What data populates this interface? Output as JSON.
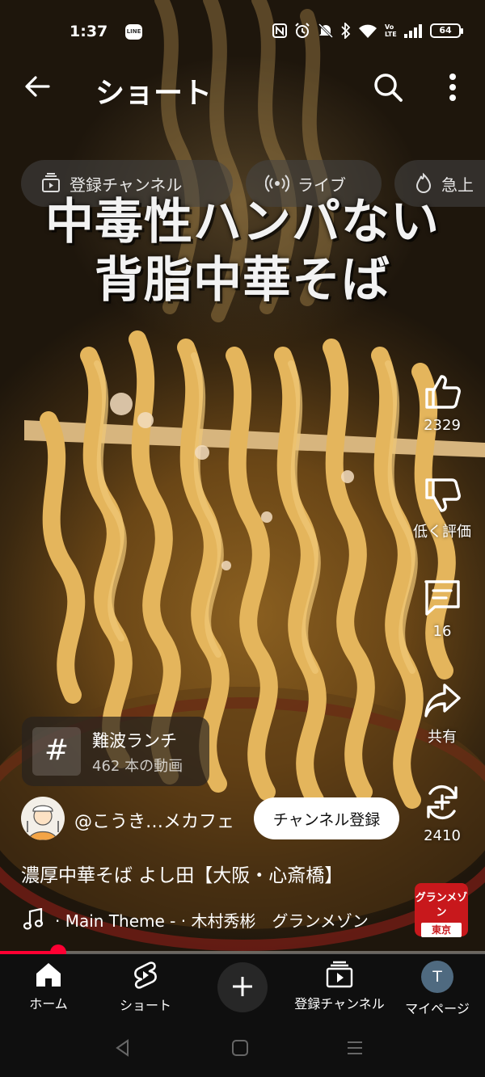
{
  "status_bar": {
    "time": "1:37",
    "line_badge": "LINE",
    "volte": "Vo LTE",
    "battery": "64"
  },
  "header": {
    "title": "ショート"
  },
  "chips": [
    {
      "label": "登録チャンネル",
      "icon": "subscriptions-icon"
    },
    {
      "label": "ライブ",
      "icon": "live-icon"
    },
    {
      "label": "急上",
      "icon": "trending-icon"
    }
  ],
  "video": {
    "title_line1": "中毒性ハンパない",
    "title_line2": "背脂中華そば"
  },
  "actions": {
    "like_count": "2329",
    "dislike_label": "低く評価",
    "comment_count": "16",
    "share_label": "共有",
    "remix_count": "2410"
  },
  "hashtag": {
    "symbol": "#",
    "name": "難波ランチ",
    "count": "462 本の動画"
  },
  "channel": {
    "name": "@こうき…メカフェ",
    "subscribe_label": "チャンネル登録"
  },
  "description": "濃厚中華そば よし田【大阪・心斎橋】",
  "music": {
    "text": "· Main Theme - · 木村秀彬　グランメゾン",
    "thumb_line1": "グランメゾン",
    "thumb_line2": "東京"
  },
  "progress": {
    "fraction": 0.12
  },
  "bottom_nav": {
    "home": "ホーム",
    "shorts": "ショート",
    "subscriptions": "登録チャンネル",
    "mypage": "マイページ",
    "user_initial": "T"
  },
  "colors": {
    "accent": "#ff0033",
    "nav_bg": "#0f0f0f",
    "noodle": "#e0b35a"
  }
}
